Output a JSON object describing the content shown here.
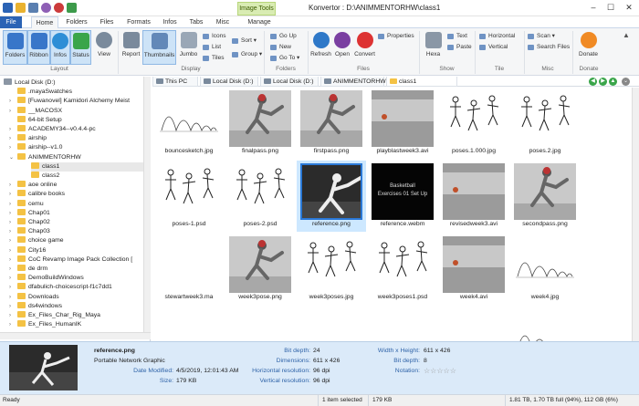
{
  "window": {
    "title": "Konvertor : D:\\ANIMMENTORHW\\class1",
    "context_tab": "Image Tools"
  },
  "tabs": [
    {
      "label": "File",
      "kind": "file"
    },
    {
      "label": "Home",
      "kind": "sel"
    },
    {
      "label": "Folders",
      "kind": ""
    },
    {
      "label": "Files",
      "kind": ""
    },
    {
      "label": "Formats",
      "kind": ""
    },
    {
      "label": "Infos",
      "kind": ""
    },
    {
      "label": "Tabs",
      "kind": ""
    },
    {
      "label": "Misc",
      "kind": ""
    },
    {
      "label": "Manage",
      "kind": ""
    }
  ],
  "ribbon": {
    "layout": {
      "folders": "Folders",
      "ribbon": "Ribbon",
      "infos": "Infos",
      "status": "Status",
      "view": "View",
      "group": "Layout"
    },
    "display": {
      "report": "Report",
      "thumbnails": "Thumbnails",
      "jumbo": "Jumbo",
      "icons": "Icons",
      "list": "List",
      "tiles": "Tiles",
      "sort": "Sort",
      "group_btn": "Group",
      "group": "Display"
    },
    "folders": {
      "go_up": "Go Up",
      "new": "New",
      "go_to": "Go To",
      "group": "Folders"
    },
    "files": {
      "refresh": "Refresh",
      "open": "Open",
      "convert": "Convert",
      "properties": "Properties",
      "group": "Files"
    },
    "show": {
      "hexa": "Hexa",
      "text": "Text",
      "paste": "Paste",
      "group": "Show"
    },
    "tile": {
      "horizontal": "Horizontal",
      "vertical": "Vertical",
      "group": "Tile"
    },
    "misc": {
      "scan": "Scan",
      "search_files": "Search Files",
      "group": "Misc"
    },
    "donate": {
      "donate": "Donate",
      "group": "Donate"
    }
  },
  "tree": [
    {
      "label": "Local Disk (D:)",
      "depth": 0,
      "exp": "v"
    },
    {
      "label": ".mayaSwatches",
      "depth": 1,
      "exp": ""
    },
    {
      "label": "[Fuwanovel] Kamidori Alchemy Meist",
      "depth": 1,
      "exp": ">"
    },
    {
      "label": "__MACOSX",
      "depth": 1,
      "exp": ">"
    },
    {
      "label": "64-bit Setup",
      "depth": 1,
      "exp": ""
    },
    {
      "label": "ACADEMY34--v0.4.4-pc",
      "depth": 1,
      "exp": ">"
    },
    {
      "label": "airship",
      "depth": 1,
      "exp": ">"
    },
    {
      "label": "airship--v1.0",
      "depth": 1,
      "exp": ">"
    },
    {
      "label": "ANIMMENTORHW",
      "depth": 1,
      "exp": "v"
    },
    {
      "label": "class1",
      "depth": 2,
      "exp": "",
      "sel": true
    },
    {
      "label": "class2",
      "depth": 2,
      "exp": ""
    },
    {
      "label": "aoe online",
      "depth": 1,
      "exp": ">"
    },
    {
      "label": "calibre books",
      "depth": 1,
      "exp": ">"
    },
    {
      "label": "cemu",
      "depth": 1,
      "exp": ">"
    },
    {
      "label": "Chap01",
      "depth": 1,
      "exp": ">"
    },
    {
      "label": "Chap02",
      "depth": 1,
      "exp": ">"
    },
    {
      "label": "Chap03",
      "depth": 1,
      "exp": ">"
    },
    {
      "label": "choice game",
      "depth": 1,
      "exp": ">"
    },
    {
      "label": "City16",
      "depth": 1,
      "exp": ">"
    },
    {
      "label": "CoC Revamp Image Pack Collection [",
      "depth": 1,
      "exp": ">"
    },
    {
      "label": "de drm",
      "depth": 1,
      "exp": ">"
    },
    {
      "label": "DemoBuildWindows",
      "depth": 1,
      "exp": ">"
    },
    {
      "label": "dfabulich-choicescript-f1c7dd1",
      "depth": 1,
      "exp": ">"
    },
    {
      "label": "Downloads",
      "depth": 1,
      "exp": ">"
    },
    {
      "label": "ds4windows",
      "depth": 1,
      "exp": ">"
    },
    {
      "label": "Ex_Files_Char_Rig_Maya",
      "depth": 1,
      "exp": ">"
    },
    {
      "label": "Ex_Files_HumanIK",
      "depth": 1,
      "exp": ">"
    }
  ],
  "breadcrumb": [
    "This PC",
    "Local Disk (D:)",
    "Local Disk (D:)",
    "ANIMMENTORHW",
    "class1"
  ],
  "files": [
    {
      "name": "bouncesketch.jpg",
      "kind": "sketch"
    },
    {
      "name": "finalpass.png",
      "kind": "fig"
    },
    {
      "name": "firstpass.png",
      "kind": "fig"
    },
    {
      "name": "playblastweek3.avi",
      "kind": "ball"
    },
    {
      "name": "poses.1.000.jpg",
      "kind": "stick"
    },
    {
      "name": "poses.2.jpg",
      "kind": "stick"
    },
    {
      "name": "poses-1.psd",
      "kind": "stick"
    },
    {
      "name": "poses-2.psd",
      "kind": "stick"
    },
    {
      "name": "reference.png",
      "kind": "ref",
      "sel": true
    },
    {
      "name": "reference.webm",
      "kind": "black",
      "text1": "Basketball",
      "text2": "Exercises 01 Set Up"
    },
    {
      "name": "revisedweek3.avi",
      "kind": "ball"
    },
    {
      "name": "secondpass.png",
      "kind": "fig"
    },
    {
      "name": "stewartweek3.ma",
      "kind": "blank"
    },
    {
      "name": "week3pose.png",
      "kind": "fig"
    },
    {
      "name": "week3poses.jpg",
      "kind": "stick"
    },
    {
      "name": "week3poses1.psd",
      "kind": "stick"
    },
    {
      "name": "week4.avi",
      "kind": "ball"
    },
    {
      "name": "week4.jpg",
      "kind": "sketch"
    },
    {
      "name": "",
      "kind": "blank"
    },
    {
      "name": "",
      "kind": "blank"
    },
    {
      "name": "",
      "kind": "blank"
    },
    {
      "name": "",
      "kind": "blank"
    },
    {
      "name": "",
      "kind": "blank"
    },
    {
      "name": "",
      "kind": "sketch"
    }
  ],
  "details": {
    "name": "reference.png",
    "type": "Portable Network Graphic",
    "date_label": "Date Modified:",
    "date": "4/5/2019, 12:01:43 AM",
    "size_label": "Size:",
    "size": "179 KB",
    "bitdepth_label": "Bit depth:",
    "bitdepth": "24",
    "dims_label": "Dimensions:",
    "dims": "611 x 426",
    "hres_label": "Horizontal resolution:",
    "hres": "96 dpi",
    "vres_label": "Vertical resolution:",
    "vres": "96 dpi",
    "wh_label": "Width x Height:",
    "wh": "611 x 426",
    "bd2_label": "Bit depth:",
    "bd2": "8",
    "notation_label": "Notation:",
    "stars": "☆☆☆☆☆"
  },
  "status": {
    "ready": "Ready",
    "selected": "1 item selected",
    "size": "179 KB",
    "disk": "1.81 TB, 1.70 TB full (94%), 112 GB (6%)"
  }
}
